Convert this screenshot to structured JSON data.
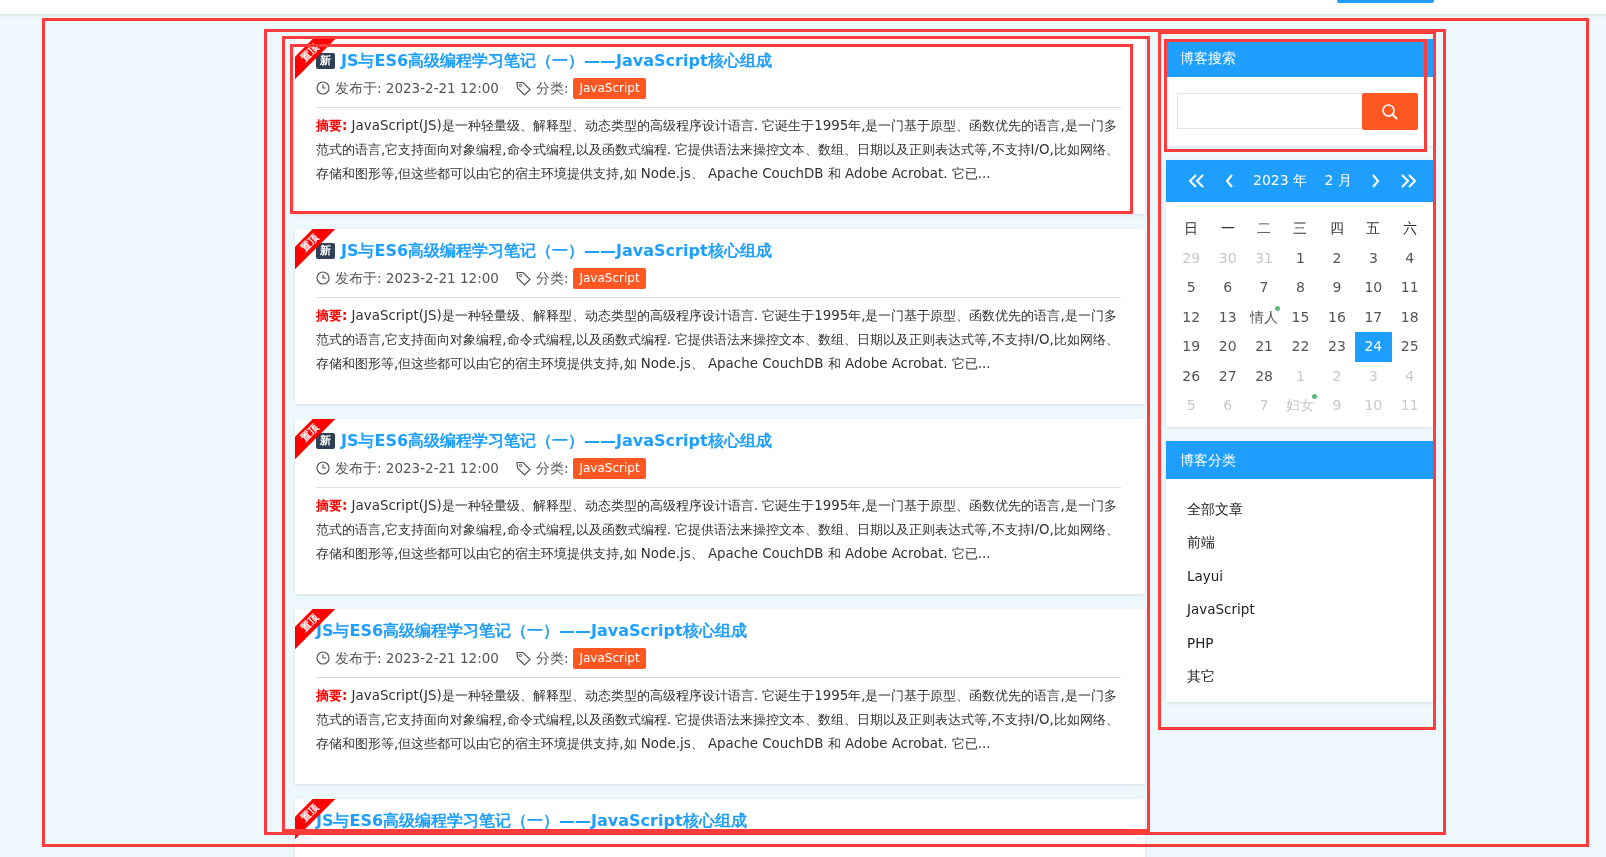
{
  "posts": [
    {
      "ribbon": "置顶",
      "badge": "新",
      "title": "JS与ES6高级编程学习笔记（一）——JavaScript核心组成",
      "published": "发布于: 2023-2-21 12:00",
      "category_label": "分类:",
      "category": "JavaScript",
      "summary_label": "摘要:",
      "summary": "JavaScript(JS)是一种轻量级、解释型、动态类型的高级程序设计语言. 它诞生于1995年,是一门基于原型、函数优先的语言,是一门多范式的语言,它支持面向对象编程,命令式编程,以及函数式编程. 它提供语法来操控文本、数组、日期以及正则表达式等,不支持I/O,比如网络、存储和图形等,但这些都可以由它的宿主环境提供支持,如 Node.js、 Apache CouchDB 和 Adobe Acrobat. 它已..."
    },
    {
      "ribbon": "置顶",
      "badge": "新",
      "title": "JS与ES6高级编程学习笔记（一）——JavaScript核心组成",
      "published": "发布于: 2023-2-21 12:00",
      "category_label": "分类:",
      "category": "JavaScript",
      "summary_label": "摘要:",
      "summary": "JavaScript(JS)是一种轻量级、解释型、动态类型的高级程序设计语言. 它诞生于1995年,是一门基于原型、函数优先的语言,是一门多范式的语言,它支持面向对象编程,命令式编程,以及函数式编程. 它提供语法来操控文本、数组、日期以及正则表达式等,不支持I/O,比如网络、存储和图形等,但这些都可以由它的宿主环境提供支持,如 Node.js、 Apache CouchDB 和 Adobe Acrobat. 它已..."
    },
    {
      "ribbon": "置顶",
      "badge": "新",
      "title": "JS与ES6高级编程学习笔记（一）——JavaScript核心组成",
      "published": "发布于: 2023-2-21 12:00",
      "category_label": "分类:",
      "category": "JavaScript",
      "summary_label": "摘要:",
      "summary": "JavaScript(JS)是一种轻量级、解释型、动态类型的高级程序设计语言. 它诞生于1995年,是一门基于原型、函数优先的语言,是一门多范式的语言,它支持面向对象编程,命令式编程,以及函数式编程. 它提供语法来操控文本、数组、日期以及正则表达式等,不支持I/O,比如网络、存储和图形等,但这些都可以由它的宿主环境提供支持,如 Node.js、 Apache CouchDB 和 Adobe Acrobat. 它已..."
    },
    {
      "ribbon": "置顶",
      "title": "JS与ES6高级编程学习笔记（一）——JavaScript核心组成",
      "published": "发布于: 2023-2-21 12:00",
      "category_label": "分类:",
      "category": "JavaScript",
      "summary_label": "摘要:",
      "summary": "JavaScript(JS)是一种轻量级、解释型、动态类型的高级程序设计语言. 它诞生于1995年,是一门基于原型、函数优先的语言,是一门多范式的语言,它支持面向对象编程,命令式编程,以及函数式编程. 它提供语法来操控文本、数组、日期以及正则表达式等,不支持I/O,比如网络、存储和图形等,但这些都可以由它的宿主环境提供支持,如 Node.js、 Apache CouchDB 和 Adobe Acrobat. 它已..."
    },
    {
      "ribbon": "置顶",
      "title": "JS与ES6高级编程学习笔记（一）——JavaScript核心组成"
    }
  ],
  "search": {
    "title": "博客搜索"
  },
  "calendar": {
    "year": "2023 年",
    "month": "2 月",
    "weekdays": [
      "日",
      "一",
      "二",
      "三",
      "四",
      "五",
      "六"
    ],
    "days": [
      {
        "text": "29",
        "muted": true,
        "selected": false
      },
      {
        "text": "30",
        "muted": true,
        "selected": false
      },
      {
        "text": "31",
        "muted": true,
        "selected": false
      },
      {
        "text": "1",
        "muted": false,
        "selected": false
      },
      {
        "text": "2",
        "muted": false,
        "selected": false
      },
      {
        "text": "3",
        "muted": false,
        "selected": false
      },
      {
        "text": "4",
        "muted": false,
        "selected": false
      },
      {
        "text": "5",
        "muted": false,
        "selected": false
      },
      {
        "text": "6",
        "muted": false,
        "selected": false
      },
      {
        "text": "7",
        "muted": false,
        "selected": false
      },
      {
        "text": "8",
        "muted": false,
        "selected": false
      },
      {
        "text": "9",
        "muted": false,
        "selected": false
      },
      {
        "text": "10",
        "muted": false,
        "selected": false
      },
      {
        "text": "11",
        "muted": false,
        "selected": false
      },
      {
        "text": "12",
        "muted": false,
        "selected": false
      },
      {
        "text": "13",
        "muted": false,
        "selected": false
      },
      {
        "text": "情人",
        "muted": false,
        "selected": false,
        "color": "#5fb878"
      },
      {
        "text": "15",
        "muted": false,
        "selected": false
      },
      {
        "text": "16",
        "muted": false,
        "selected": false
      },
      {
        "text": "17",
        "muted": false,
        "selected": false
      },
      {
        "text": "18",
        "muted": false,
        "selected": false
      },
      {
        "text": "19",
        "muted": false,
        "selected": false
      },
      {
        "text": "20",
        "muted": false,
        "selected": false
      },
      {
        "text": "21",
        "muted": false,
        "selected": false
      },
      {
        "text": "22",
        "muted": false,
        "selected": false
      },
      {
        "text": "23",
        "muted": false,
        "selected": false
      },
      {
        "text": "24",
        "muted": false,
        "selected": true
      },
      {
        "text": "25",
        "muted": false,
        "selected": false
      },
      {
        "text": "26",
        "muted": false,
        "selected": false
      },
      {
        "text": "27",
        "muted": false,
        "selected": false
      },
      {
        "text": "28",
        "muted": false,
        "selected": false
      },
      {
        "text": "1",
        "muted": true,
        "selected": false
      },
      {
        "text": "2",
        "muted": true,
        "selected": false
      },
      {
        "text": "3",
        "muted": true,
        "selected": false
      },
      {
        "text": "4",
        "muted": true,
        "selected": false
      },
      {
        "text": "5",
        "muted": true,
        "selected": false
      },
      {
        "text": "6",
        "muted": true,
        "selected": false
      },
      {
        "text": "7",
        "muted": true,
        "selected": false
      },
      {
        "text": "妇女",
        "muted": true,
        "selected": false,
        "color": "#5fb878"
      },
      {
        "text": "9",
        "muted": true,
        "selected": false
      },
      {
        "text": "10",
        "muted": true,
        "selected": false
      },
      {
        "text": "11",
        "muted": true,
        "selected": false
      }
    ]
  },
  "categories": {
    "title": "博客分类",
    "items": [
      "全部文章",
      "前端",
      "Layui",
      "JavaScript",
      "PHP",
      "其它"
    ]
  }
}
